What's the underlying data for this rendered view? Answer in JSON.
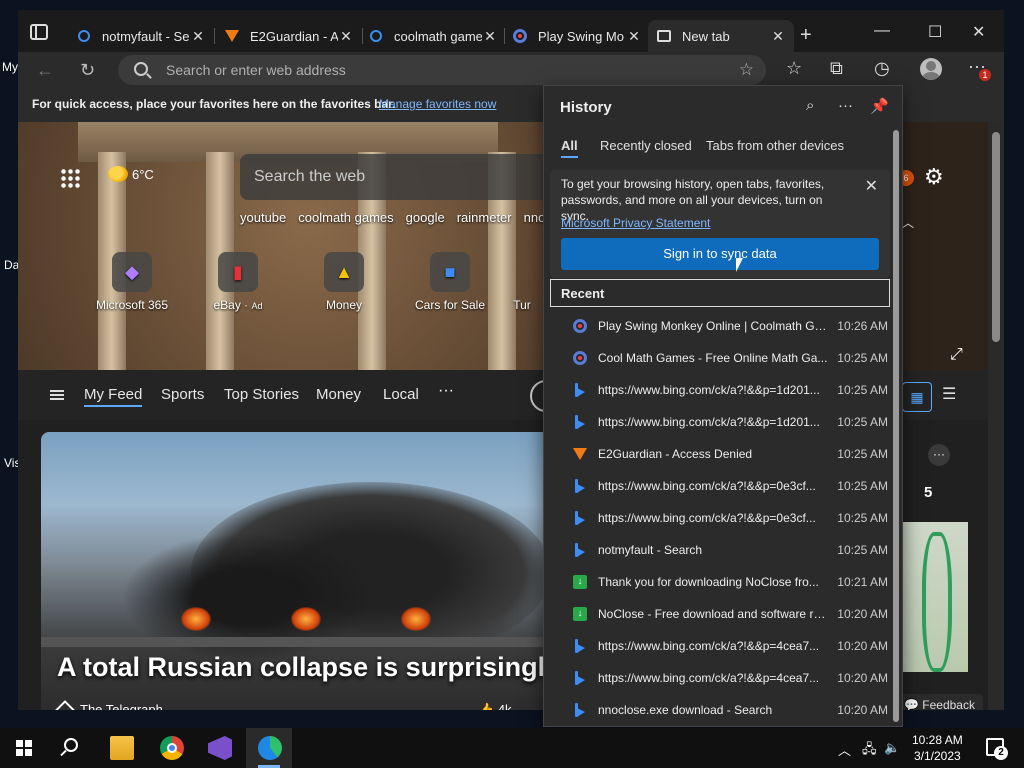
{
  "desktop": {
    "labels": [
      "My",
      "Da",
      "Vis"
    ]
  },
  "tabs": [
    {
      "title": "notmyfault - Se",
      "icon": "search-icon"
    },
    {
      "title": "E2Guardian - A",
      "icon": "e2guardian-icon"
    },
    {
      "title": "coolmath game",
      "icon": "search-icon"
    },
    {
      "title": "Play Swing Mo",
      "icon": "coolmath-icon"
    },
    {
      "title": "New tab",
      "icon": "new-tab-page-icon"
    }
  ],
  "address": {
    "placeholder": "Search or enter web address"
  },
  "favbar": {
    "message": "For quick access, place your favorites here on the favorites bar.",
    "link": "Manage favorites now"
  },
  "profile": {
    "notification_count": "1"
  },
  "ntp": {
    "weather": "6°C",
    "search_placeholder": "Search the web",
    "quick_links": [
      "youtube",
      "coolmath games",
      "google",
      "rainmeter",
      "nnoc"
    ],
    "tiles": [
      {
        "label": "Microsoft 365",
        "ad": ""
      },
      {
        "label": "eBay",
        "ad": "Ad"
      },
      {
        "label": "Money",
        "ad": ""
      },
      {
        "label": "Cars for Sale",
        "ad": ""
      },
      {
        "label": "Tur",
        "ad": ""
      }
    ],
    "notification_badge": "6",
    "feed_tabs": [
      "My Feed",
      "Sports",
      "Top Stories",
      "Money",
      "Local"
    ],
    "headline": "A total Russian collapse is surprisingly",
    "source": "The Telegraph",
    "likes": "4k",
    "side_number": "5",
    "feedback": "Feedback"
  },
  "history": {
    "title": "History",
    "tabs": [
      "All",
      "Recently closed",
      "Tabs from other devices"
    ],
    "sync_message": "To get your browsing history, open tabs, favorites, passwords, and more on all your devices, turn on sync.",
    "privacy_link": "Microsoft Privacy Statement",
    "sync_button": "Sign in to sync data",
    "recent_header": "Recent",
    "items": [
      {
        "title": "Play Swing Monkey Online | Coolmath Ga...",
        "time": "10:26 AM",
        "icon": "coolmath"
      },
      {
        "title": "Cool Math Games - Free Online Math Ga...",
        "time": "10:25 AM",
        "icon": "coolmath"
      },
      {
        "title": "https://www.bing.com/ck/a?!&&p=1d201...",
        "time": "10:25 AM",
        "icon": "bing"
      },
      {
        "title": "https://www.bing.com/ck/a?!&&p=1d201...",
        "time": "10:25 AM",
        "icon": "bing"
      },
      {
        "title": "E2Guardian - Access Denied",
        "time": "10:25 AM",
        "icon": "e2guardian"
      },
      {
        "title": "https://www.bing.com/ck/a?!&&p=0e3cf...",
        "time": "10:25 AM",
        "icon": "bing"
      },
      {
        "title": "https://www.bing.com/ck/a?!&&p=0e3cf...",
        "time": "10:25 AM",
        "icon": "bing"
      },
      {
        "title": "notmyfault - Search",
        "time": "10:25 AM",
        "icon": "bing"
      },
      {
        "title": "Thank you for downloading NoClose fro...",
        "time": "10:21 AM",
        "icon": "download"
      },
      {
        "title": "NoClose - Free download and software re...",
        "time": "10:20 AM",
        "icon": "download"
      },
      {
        "title": "https://www.bing.com/ck/a?!&&p=4cea7...",
        "time": "10:20 AM",
        "icon": "bing"
      },
      {
        "title": "https://www.bing.com/ck/a?!&&p=4cea7...",
        "time": "10:20 AM",
        "icon": "bing"
      },
      {
        "title": "nnoclose.exe download - Search",
        "time": "10:20 AM",
        "icon": "bing"
      }
    ]
  },
  "taskbar": {
    "time": "10:28 AM",
    "date": "3/1/2023",
    "notification_count": "2"
  },
  "colors": {
    "accent": "#0f6cbd",
    "link": "#7fb7ff",
    "tab_active": "#2b2b2b"
  }
}
